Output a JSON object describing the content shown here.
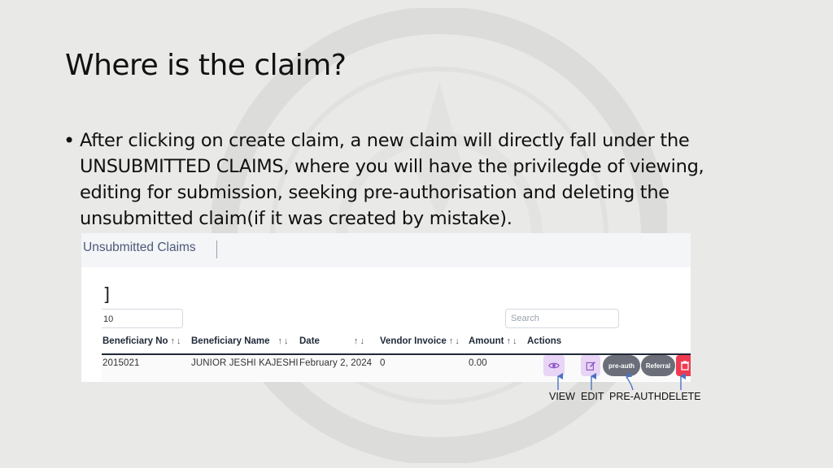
{
  "slide": {
    "title": "Where is the claim?",
    "bullet": "After clicking on create claim, a new claim will directly fall under the UNSUBMITTED CLAIMS, where you will have the privilegde of viewing, editing for submission, seeking pre-authorisation and deleting the unsubmitted claim(if it was created by mistake)."
  },
  "screenshot": {
    "header_title": "Unsubmitted Claims",
    "bracket": "]",
    "page_size_value": "10",
    "search_placeholder": "Search",
    "columns": [
      "Beneficiary No",
      "Beneficiary Name",
      "Date",
      "Vendor Invoice",
      "Amount",
      "Actions"
    ],
    "sort_glyph": "↑↓",
    "rows": [
      {
        "beneficiary_no": "2015021",
        "beneficiary_name": "JUNIOR JESHI KAJESHI",
        "date": "February 2, 2024",
        "vendor_invoice": "0",
        "amount": "0.00"
      }
    ],
    "actions": {
      "view_icon": "eye-icon",
      "edit_icon": "edit-icon",
      "preauth_label": "pre-auth",
      "referral_label": "Referral",
      "delete_icon": "trash-icon"
    }
  },
  "annotations": {
    "view": "VIEW",
    "edit": "EDIT",
    "preauth": "PRE-AUTH",
    "delete": "DELETE"
  },
  "colors": {
    "arrow": "#4a72c4",
    "action_light": "#e8d5f5",
    "action_pill": "#6b6e78",
    "delete": "#ef3b52",
    "header_text": "#4b5a78"
  }
}
